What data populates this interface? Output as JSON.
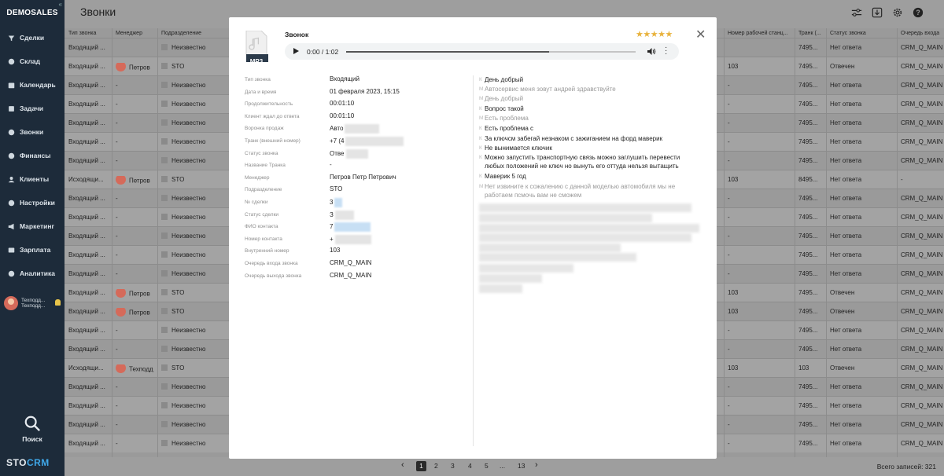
{
  "app": {
    "brand": "DEMOSALES",
    "logo_prefix": "STO",
    "logo_suffix": "CRM",
    "search_label": "Поиск"
  },
  "sidebar": {
    "items": [
      {
        "label": "Сделки",
        "icon": "funnel-icon"
      },
      {
        "label": "Склад",
        "icon": "box-icon"
      },
      {
        "label": "Календарь",
        "icon": "calendar-icon"
      },
      {
        "label": "Задачи",
        "icon": "tasks-icon"
      },
      {
        "label": "Звонки",
        "icon": "phone-icon"
      },
      {
        "label": "Финансы",
        "icon": "finance-icon"
      },
      {
        "label": "Клиенты",
        "icon": "clients-icon"
      },
      {
        "label": "Настройки",
        "icon": "gear-icon"
      },
      {
        "label": "Маркетинг",
        "icon": "megaphone-icon"
      },
      {
        "label": "Зарплата",
        "icon": "wallet-icon"
      },
      {
        "label": "Аналитика",
        "icon": "analytics-icon"
      }
    ],
    "user": {
      "line1": "Техподд...",
      "line2": "Техподд..."
    }
  },
  "header": {
    "title": "Звонки"
  },
  "table": {
    "headers": [
      "Тип звонка",
      "Менеджер",
      "Подразделение",
      "Номер рабочей станц...",
      "Транк (...",
      "Статус звонка",
      "Очередь входа"
    ],
    "rows": [
      {
        "type": "Входящий ...",
        "manager": "",
        "avatar": false,
        "dept": "Неизвестно",
        "station": "",
        "trunk": "7495...",
        "status": "Нет ответа",
        "queue": "CRM_Q_MAIN"
      },
      {
        "type": "Входящий ...",
        "manager": "Петров",
        "avatar": true,
        "dept": "STO",
        "station": "103",
        "trunk": "7495...",
        "status": "Отвечен",
        "queue": "CRM_Q_MAIN"
      },
      {
        "type": "Входящий ...",
        "manager": "-",
        "avatar": false,
        "dept": "Неизвестно",
        "station": "-",
        "trunk": "7495...",
        "status": "Нет ответа",
        "queue": "CRM_Q_MAIN"
      },
      {
        "type": "Входящий ...",
        "manager": "-",
        "avatar": false,
        "dept": "Неизвестно",
        "station": "-",
        "trunk": "7495...",
        "status": "Нет ответа",
        "queue": "CRM_Q_MAIN"
      },
      {
        "type": "Входящий ...",
        "manager": "-",
        "avatar": false,
        "dept": "Неизвестно",
        "station": "-",
        "trunk": "7495...",
        "status": "Нет ответа",
        "queue": "CRM_Q_MAIN"
      },
      {
        "type": "Входящий ...",
        "manager": "-",
        "avatar": false,
        "dept": "Неизвестно",
        "station": "-",
        "trunk": "7495...",
        "status": "Нет ответа",
        "queue": "CRM_Q_MAIN"
      },
      {
        "type": "Входящий ...",
        "manager": "-",
        "avatar": false,
        "dept": "Неизвестно",
        "station": "-",
        "trunk": "7495...",
        "status": "Нет ответа",
        "queue": "CRM_Q_MAIN"
      },
      {
        "type": "Исходящи...",
        "manager": "Петров",
        "avatar": true,
        "dept": "STO",
        "station": "103",
        "trunk": "8495...",
        "status": "Нет ответа",
        "queue": "-"
      },
      {
        "type": "Входящий ...",
        "manager": "-",
        "avatar": false,
        "dept": "Неизвестно",
        "station": "-",
        "trunk": "7495...",
        "status": "Нет ответа",
        "queue": "CRM_Q_MAIN"
      },
      {
        "type": "Входящий ...",
        "manager": "-",
        "avatar": false,
        "dept": "Неизвестно",
        "station": "-",
        "trunk": "7495...",
        "status": "Нет ответа",
        "queue": "CRM_Q_MAIN"
      },
      {
        "type": "Входящий ...",
        "manager": "-",
        "avatar": false,
        "dept": "Неизвестно",
        "station": "-",
        "trunk": "7495...",
        "status": "Нет ответа",
        "queue": "CRM_Q_MAIN"
      },
      {
        "type": "Входящий ...",
        "manager": "-",
        "avatar": false,
        "dept": "Неизвестно",
        "station": "-",
        "trunk": "7495...",
        "status": "Нет ответа",
        "queue": "CRM_Q_MAIN"
      },
      {
        "type": "Входящий ...",
        "manager": "-",
        "avatar": false,
        "dept": "Неизвестно",
        "station": "-",
        "trunk": "7495...",
        "status": "Нет ответа",
        "queue": "CRM_Q_MAIN"
      },
      {
        "type": "Входящий ...",
        "manager": "Петров",
        "avatar": true,
        "dept": "STO",
        "station": "103",
        "trunk": "7495...",
        "status": "Отвечен",
        "queue": "CRM_Q_MAIN"
      },
      {
        "type": "Входящий ...",
        "manager": "Петров",
        "avatar": true,
        "dept": "STO",
        "station": "103",
        "trunk": "7495...",
        "status": "Отвечен",
        "queue": "CRM_Q_MAIN"
      },
      {
        "type": "Входящий ...",
        "manager": "-",
        "avatar": false,
        "dept": "Неизвестно",
        "station": "-",
        "trunk": "7495...",
        "status": "Нет ответа",
        "queue": "CRM_Q_MAIN"
      },
      {
        "type": "Входящий ...",
        "manager": "-",
        "avatar": false,
        "dept": "Неизвестно",
        "station": "-",
        "trunk": "7495...",
        "status": "Нет ответа",
        "queue": "CRM_Q_MAIN"
      },
      {
        "type": "Исходящи...",
        "manager": "Техподд",
        "avatar": true,
        "dept": "STO",
        "station": "103",
        "trunk": "103",
        "status": "Отвечен",
        "queue": "CRM_Q_MAIN"
      },
      {
        "type": "Входящий ...",
        "manager": "-",
        "avatar": false,
        "dept": "Неизвестно",
        "station": "-",
        "trunk": "7495...",
        "status": "Нет ответа",
        "queue": "CRM_Q_MAIN"
      },
      {
        "type": "Входящий ...",
        "manager": "-",
        "avatar": false,
        "dept": "Неизвестно",
        "station": "-",
        "trunk": "7495...",
        "status": "Нет ответа",
        "queue": "CRM_Q_MAIN"
      },
      {
        "type": "Входящий ...",
        "manager": "-",
        "avatar": false,
        "dept": "Неизвестно",
        "station": "-",
        "trunk": "7495...",
        "status": "Нет ответа",
        "queue": "CRM_Q_MAIN"
      },
      {
        "type": "Входящий ...",
        "manager": "-",
        "avatar": false,
        "dept": "Неизвестно",
        "station": "-",
        "trunk": "7495...",
        "status": "Нет ответа",
        "queue": "CRM_Q_MAIN"
      }
    ]
  },
  "pagination": {
    "prev": "‹",
    "next": "›",
    "pages": [
      "1",
      "2",
      "3",
      "4",
      "5",
      "...",
      "13"
    ],
    "active": "1",
    "total": "Всего записей: 321"
  },
  "modal": {
    "file_badge": "MP3",
    "title": "Звонок",
    "rating": 5,
    "stars": "★★★★★",
    "close": "✕",
    "player": {
      "time": "0:00 / 1:02",
      "progress": 0.7
    },
    "fields": [
      {
        "label": "Тип звонка",
        "value": "Входящий",
        "blur": 0,
        "blur_color": ""
      },
      {
        "label": "Дата и время",
        "value": "01 февраля 2023, 15:15",
        "blur": 0,
        "blur_color": ""
      },
      {
        "label": "Продолжительность",
        "value": "00:01:10",
        "blur": 0,
        "blur_color": ""
      },
      {
        "label": "Клиент ждал до ответа",
        "value": "00:01:10",
        "blur": 0,
        "blur_color": ""
      },
      {
        "label": "Воронка продаж",
        "value": "Авто",
        "blur": 1,
        "blur_color": "gray"
      },
      {
        "label": "Транк (внешний номер)",
        "value": "+7 (4",
        "blur": 1,
        "blur_color": "gray"
      },
      {
        "label": "Статус звонка",
        "value": "Отве",
        "blur": 1,
        "blur_color": "gray"
      },
      {
        "label": "Название Транка",
        "value": "-",
        "blur": 0,
        "blur_color": ""
      },
      {
        "label": "Менеджер",
        "value": "Петров Петр Петрович",
        "blur": 0,
        "blur_color": ""
      },
      {
        "label": "Подразделение",
        "value": "STO",
        "blur": 0,
        "blur_color": ""
      },
      {
        "label": "№ сделки",
        "value": "3",
        "blur": 1,
        "blur_color": "blue"
      },
      {
        "label": "Статус сделки",
        "value": "З",
        "blur": 1,
        "blur_color": "gray"
      },
      {
        "label": "ФИО контакта",
        "value": "7",
        "blur": 1,
        "blur_color": "blue"
      },
      {
        "label": "Номер контакта",
        "value": "+",
        "blur": 1,
        "blur_color": "gray"
      },
      {
        "label": "Внутренний номер",
        "value": "103",
        "blur": 0,
        "blur_color": ""
      },
      {
        "label": "Очередь входа звонка",
        "value": "CRM_Q_MAIN",
        "blur": 0,
        "blur_color": ""
      },
      {
        "label": "Очередь выхода звонка",
        "value": "CRM_Q_MAIN",
        "blur": 0,
        "blur_color": ""
      }
    ],
    "transcript": [
      {
        "speaker": "К",
        "text": "День добрый",
        "role": "k"
      },
      {
        "speaker": "М",
        "text": "Автосервис меня зовут андрей здравствуйте",
        "role": "m"
      },
      {
        "speaker": "М",
        "text": "День добрый",
        "role": "m"
      },
      {
        "speaker": "К",
        "text": "Вопрос такой",
        "role": "k"
      },
      {
        "speaker": "М",
        "text": "Есть проблема",
        "role": "m"
      },
      {
        "speaker": "К",
        "text": "Есть проблема с",
        "role": "k"
      },
      {
        "speaker": "К",
        "text": "За ключсм забегай незнаком с зажиганием на форд маверик",
        "role": "k"
      },
      {
        "speaker": "К",
        "text": "Не вынимается ключик",
        "role": "k"
      },
      {
        "speaker": "К",
        "text": "Можно запустить транспортную связь можно заглушить перевести любых положений не ключ но вынуть его оттуда нельзя вытащить",
        "role": "k"
      },
      {
        "speaker": "К",
        "text": "Маверик 5 год",
        "role": "k"
      },
      {
        "speaker": "М",
        "text": "Нет извините к сожалению с данной моделью автомобиля мы не работаем псмочь вам не сможем",
        "role": "m"
      }
    ]
  },
  "colors": {
    "sidebar_bg": "#1d2b3a",
    "accent_blue": "#3fa7e8",
    "star": "#e8b23c",
    "overlay": "#9e9e9e"
  }
}
